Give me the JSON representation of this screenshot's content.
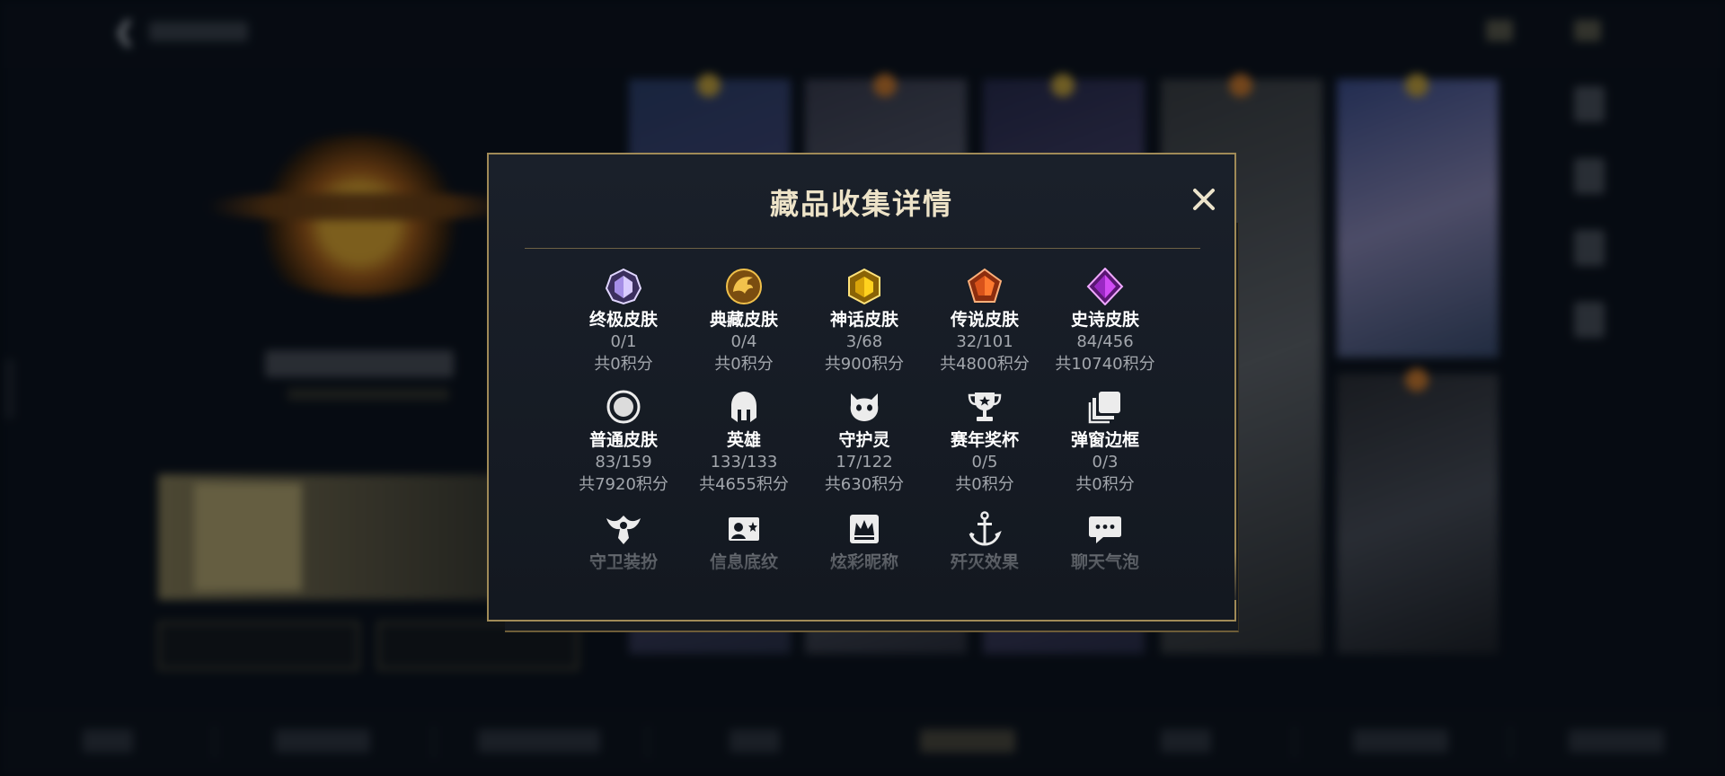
{
  "modal": {
    "title": "藏品收集详情",
    "close_symbol": "✕",
    "items": [
      {
        "label": "终极皮肤",
        "count": "0/1",
        "points": "共0积分",
        "icon": "ultimate-skin-gem-icon",
        "color": "#c6b6f2"
      },
      {
        "label": "典藏皮肤",
        "count": "0/4",
        "points": "共0积分",
        "icon": "collection-skin-dragon-icon",
        "color": "#e3a92f"
      },
      {
        "label": "神话皮肤",
        "count": "3/68",
        "points": "共900积分",
        "icon": "mythic-skin-gem-icon",
        "color": "#f2c318"
      },
      {
        "label": "传说皮肤",
        "count": "32/101",
        "points": "共4800积分",
        "icon": "legend-skin-gem-icon",
        "color": "#f06a28"
      },
      {
        "label": "史诗皮肤",
        "count": "84/456",
        "points": "共10740积分",
        "icon": "epic-skin-gem-icon",
        "color": "#c237e6"
      },
      {
        "label": "普通皮肤",
        "count": "83/159",
        "points": "共7920积分",
        "icon": "normal-skin-ring-icon",
        "color": "#e8e8e8"
      },
      {
        "label": "英雄",
        "count": "133/133",
        "points": "共4655积分",
        "icon": "hero-helmet-icon",
        "color": "#e8e8e8"
      },
      {
        "label": "守护灵",
        "count": "17/122",
        "points": "共630积分",
        "icon": "guardian-spirit-icon",
        "color": "#e8e8e8"
      },
      {
        "label": "赛年奖杯",
        "count": "0/5",
        "points": "共0积分",
        "icon": "season-trophy-icon",
        "color": "#e8e8e8"
      },
      {
        "label": "弹窗边框",
        "count": "0/3",
        "points": "共0积分",
        "icon": "popup-frame-icon",
        "color": "#e8e8e8"
      },
      {
        "label": "守卫装扮",
        "count": "",
        "points": "",
        "icon": "guard-outfit-icon",
        "color": "#e8e8e8"
      },
      {
        "label": "信息底纹",
        "count": "",
        "points": "",
        "icon": "info-background-icon",
        "color": "#e8e8e8"
      },
      {
        "label": "炫彩昵称",
        "count": "",
        "points": "",
        "icon": "colorful-nickname-icon",
        "color": "#e8e8e8"
      },
      {
        "label": "歼灭效果",
        "count": "",
        "points": "",
        "icon": "annihilate-effect-icon",
        "color": "#e8e8e8"
      },
      {
        "label": "聊天气泡",
        "count": "",
        "points": "",
        "icon": "chat-bubble-icon",
        "color": "#e8e8e8"
      }
    ]
  },
  "colors": {
    "accent_gold": "#a08a57",
    "title_text": "#ede3c8",
    "label_text": "#ffffff",
    "secondary_text": "#a3a7ad",
    "modal_bg": "#1a202a"
  }
}
